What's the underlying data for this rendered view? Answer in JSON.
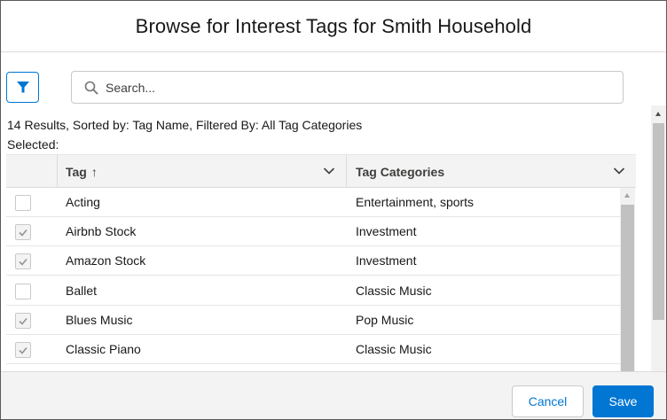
{
  "modal": {
    "title": "Browse for Interest Tags for Smith Household"
  },
  "search": {
    "placeholder": "Search...",
    "value": ""
  },
  "results_summary": "14 Results, Sorted by: Tag Name, Filtered By: All Tag Categories",
  "selected_label": "Selected:",
  "table": {
    "columns": [
      {
        "label": "Tag",
        "sort_indicator": "↑"
      },
      {
        "label": "Tag Categories"
      }
    ],
    "rows": [
      {
        "checked": false,
        "tag": "Acting",
        "categories": "Entertainment, sports"
      },
      {
        "checked": true,
        "tag": "Airbnb Stock",
        "categories": "Investment"
      },
      {
        "checked": true,
        "tag": "Amazon Stock",
        "categories": "Investment"
      },
      {
        "checked": false,
        "tag": "Ballet",
        "categories": "Classic Music"
      },
      {
        "checked": true,
        "tag": "Blues Music",
        "categories": "Pop Music"
      },
      {
        "checked": true,
        "tag": "Classic Piano",
        "categories": "Classic Music"
      }
    ]
  },
  "footer": {
    "cancel_label": "Cancel",
    "save_label": "Save"
  },
  "colors": {
    "brand": "#0176d3",
    "header_bg": "#f3f3f3",
    "border": "#dddbda"
  }
}
